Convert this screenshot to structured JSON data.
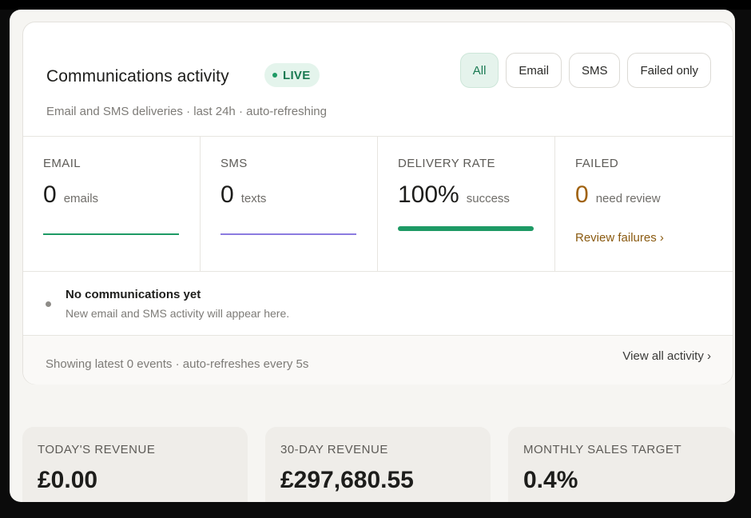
{
  "activity": {
    "title": "Communications activity",
    "live_label": "LIVE",
    "subtitle": "Email and SMS deliveries · last 24h · auto-refreshing",
    "filters": [
      {
        "label": "All",
        "active": true
      },
      {
        "label": "Email",
        "active": false
      },
      {
        "label": "SMS",
        "active": false
      },
      {
        "label": "Failed only",
        "active": false
      }
    ],
    "stats": {
      "email": {
        "label": "EMAIL",
        "value": "0",
        "unit": "emails"
      },
      "sms": {
        "label": "SMS",
        "value": "0",
        "unit": "texts"
      },
      "delivery_rate": {
        "label": "DELIVERY RATE",
        "value": "100%",
        "unit": "success",
        "fill_fraction": 1.0
      },
      "failed": {
        "label": "FAILED",
        "value": "0",
        "unit": "need review",
        "link": "Review failures ›"
      }
    },
    "empty_state": {
      "title": "No communications yet",
      "message": "New email and SMS activity will appear here."
    },
    "footer": {
      "status": "Showing latest 0 events · auto-refreshes every 5s",
      "view_all": "View all activity ›"
    }
  },
  "metrics": [
    {
      "label": "TODAY'S REVENUE",
      "value": "£0.00"
    },
    {
      "label": "30-DAY REVENUE",
      "value": "£297,680.55"
    },
    {
      "label": "MONTHLY SALES TARGET",
      "value": "0.4%"
    }
  ],
  "colors": {
    "accent_green": "#1e9a65",
    "sms_purple": "#8b7be0",
    "failed_amber": "#a0620f",
    "live_bg": "#e4f4ec"
  }
}
